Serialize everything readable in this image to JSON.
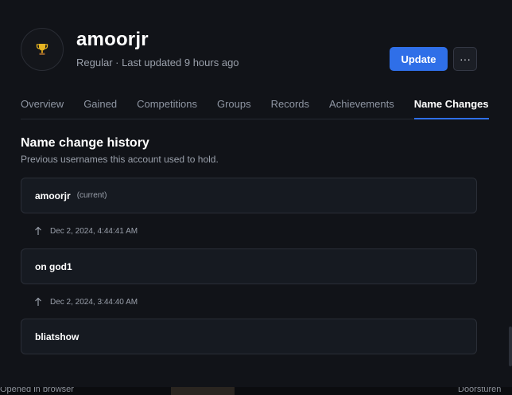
{
  "player": {
    "avatar_icon": "trophy-icon",
    "name": "amoorjr",
    "subtitle": "Regular · Last updated 9 hours ago"
  },
  "actions": {
    "update_label": "Update",
    "more_label": "···"
  },
  "tabs": [
    {
      "label": "Overview"
    },
    {
      "label": "Gained"
    },
    {
      "label": "Competitions"
    },
    {
      "label": "Groups"
    },
    {
      "label": "Records"
    },
    {
      "label": "Achievements"
    },
    {
      "label": "Name Changes",
      "active": true
    }
  ],
  "history": {
    "title": "Name change history",
    "description": "Previous usernames this account used to hold.",
    "entries": [
      {
        "name": "amoorjr",
        "tag": "(current)"
      },
      {
        "name": "on god1"
      },
      {
        "name": "bliatshow"
      }
    ],
    "changes": [
      {
        "icon": "arrow-up-icon",
        "date": "Dec 2, 2024, 4:44:41 AM"
      },
      {
        "icon": "arrow-up-icon",
        "date": "Dec 2, 2024, 3:44:40 AM"
      }
    ]
  },
  "footer": {
    "left_text": "Opened in browser",
    "right_text": "Doorsturen"
  },
  "colors": {
    "background": "#111318",
    "accent": "#2f6fe8",
    "card": "#161a21",
    "muted_text": "#9aa0ab"
  }
}
